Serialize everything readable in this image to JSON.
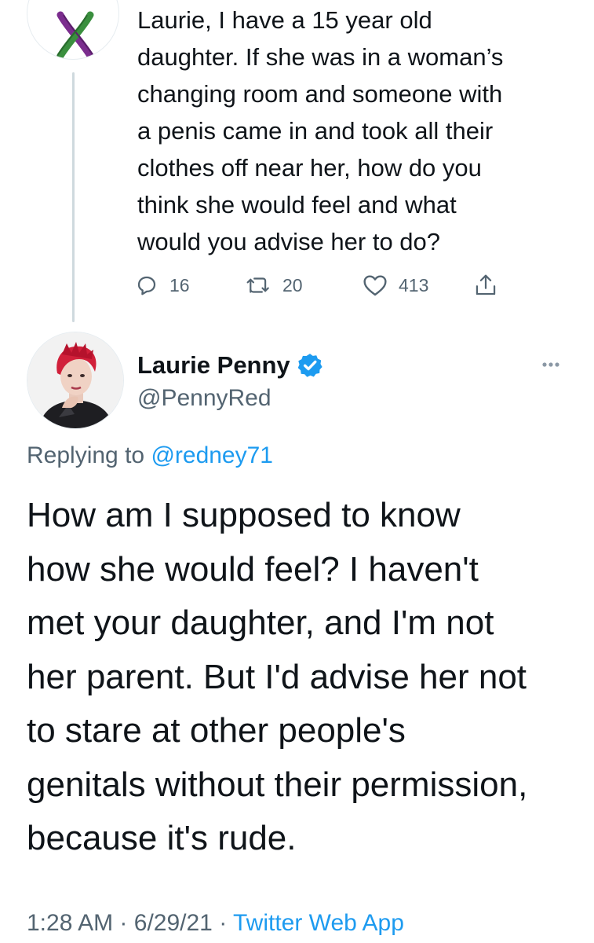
{
  "parent_tweet": {
    "text": "Laurie, I have a 15 year old\ndaughter. If she was in a woman’s\nchanging room and someone with\na penis came in  and took all their\nclothes off near her, how do you\nthink she would feel and what\nwould you advise her to do?",
    "avatar_icon": "suffragette-ribbon-icon",
    "ribbon_colors": [
      "#7b2d8e",
      "#3a8f3e",
      "#ffffff"
    ],
    "actions": {
      "reply_count": "16",
      "retweet_count": "20",
      "like_count": "413"
    }
  },
  "main_tweet": {
    "author": {
      "name": "Laurie Penny",
      "handle": "@PennyRed",
      "verified": true
    },
    "replying_to": {
      "prefix": "Replying to ",
      "mention": "@redney71"
    },
    "text": "How am I supposed to know\nhow she would feel? I haven't\nmet your daughter, and I'm not\nher parent. But I'd advise her not\nto stare at other people's\ngenitals without their permission,\nbecause it's rude.",
    "meta": {
      "time": "1:28 AM",
      "date": "6/29/21",
      "separator": "·",
      "source": "Twitter Web App"
    }
  },
  "colors": {
    "accent": "#1d9bf0",
    "secondary_text": "#536471",
    "primary_text": "#0f1419",
    "thread_line": "#cfd9de"
  }
}
